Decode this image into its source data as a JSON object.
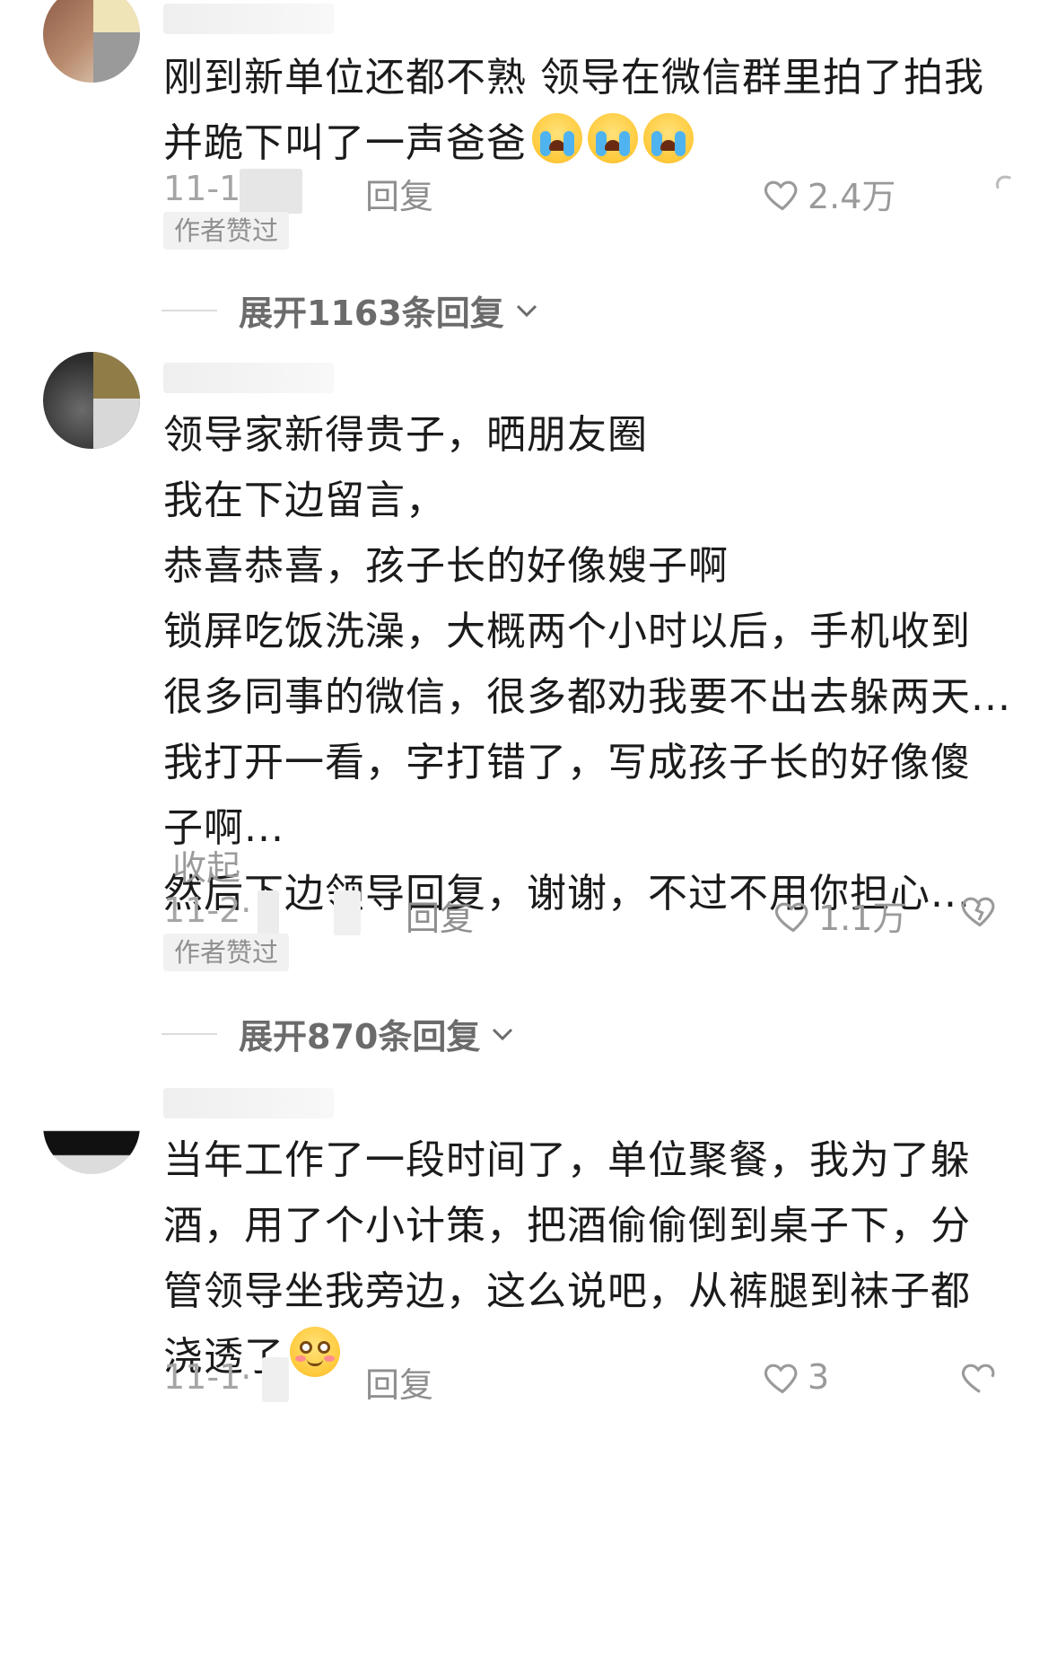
{
  "comments": [
    {
      "lines": [
        "刚到新单位还都不熟  领导在微信群里拍了拍我",
        "并跪下叫了一声爸爸"
      ],
      "emojis": [
        "loudly-crying-face",
        "loudly-crying-face",
        "loudly-crying-face"
      ],
      "date": "11-1",
      "reply_label": "回复",
      "likes": "2.4万",
      "badge": "作者赞过",
      "expand_label": "展开1163条回复"
    },
    {
      "lines": [
        "领导家新得贵子，晒朋友圈",
        "我在下边留言，",
        "恭喜恭喜，孩子长的好像嫂子啊",
        "锁屏吃饭洗澡，大概两个小时以后，手机收到",
        "很多同事的微信，很多都劝我要不出去躲两天...",
        "我打开一看，字打错了，写成孩子长的好像傻",
        "子啊...",
        "然后下边领导回复，谢谢，不过不用你担心..."
      ],
      "collapse_label": "收起",
      "date": "11-2·",
      "reply_label": "回复",
      "likes": "1.1万",
      "badge": "作者赞过",
      "expand_label": "展开870条回复"
    },
    {
      "lines": [
        "当年工作了一段时间了，单位聚餐，我为了躲",
        "酒，用了个小计策，把酒偷偷倒到桌子下，分",
        "管领导坐我旁边，这么说吧，从裤腿到袜子都",
        "浇透了"
      ],
      "emojis": [
        "flushed-smile-face"
      ],
      "date": "11-1·",
      "reply_label": "回复",
      "likes": "3"
    }
  ]
}
